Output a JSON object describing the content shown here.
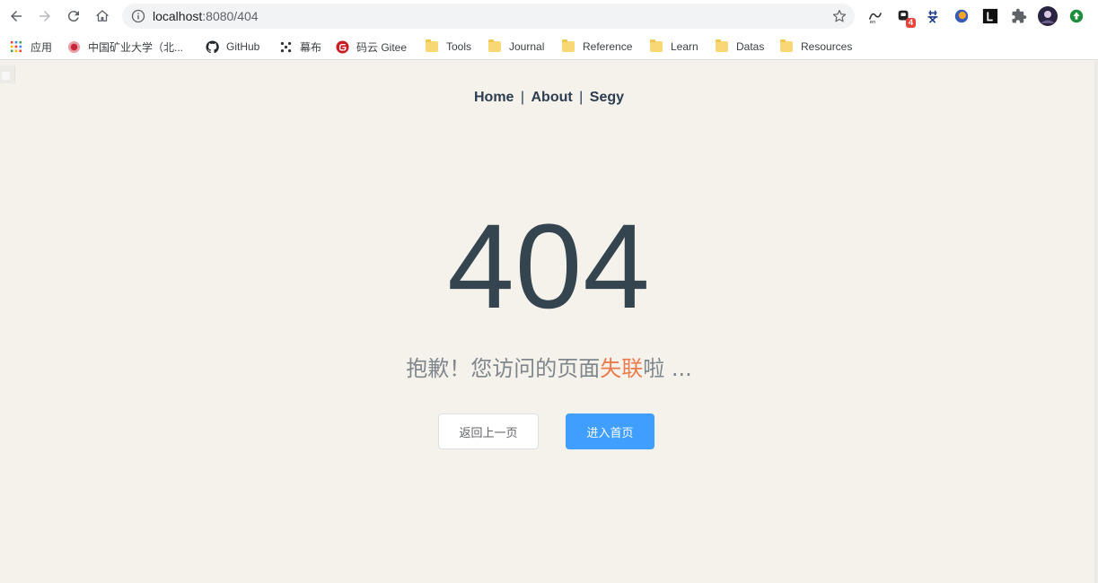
{
  "browser": {
    "url_host": "localhost",
    "url_path": ":8080/404",
    "colors": {
      "accent_orange": "#ec7a4a",
      "primary_blue": "#409eff",
      "text_dark": "#2c3e50"
    }
  },
  "extensions": [
    {
      "name": "translate-en-icon"
    },
    {
      "name": "extension-badge-icon",
      "badge": "4"
    },
    {
      "name": "mai-icon"
    },
    {
      "name": "firefox-like-icon"
    },
    {
      "name": "leetcode-icon"
    },
    {
      "name": "puzzle-icon"
    },
    {
      "name": "profile-avatar"
    },
    {
      "name": "update-icon"
    }
  ],
  "bookmarks": [
    {
      "label": "应用"
    },
    {
      "label": "中国矿业大学（北..."
    },
    {
      "label": "GitHub"
    },
    {
      "label": "幕布"
    },
    {
      "label": "码云 Gitee"
    },
    {
      "label": "Tools"
    },
    {
      "label": "Journal"
    },
    {
      "label": "Reference"
    },
    {
      "label": "Learn"
    },
    {
      "label": "Datas"
    },
    {
      "label": "Resources"
    }
  ],
  "nav": {
    "home": "Home",
    "about": "About",
    "segy": "Segy",
    "separator": "|"
  },
  "error": {
    "code": "404",
    "message_before": "抱歉！您访问的页面",
    "message_highlight": "失联",
    "message_after": "啦 ..."
  },
  "buttons": {
    "back": "返回上一页",
    "home": "进入首页"
  }
}
